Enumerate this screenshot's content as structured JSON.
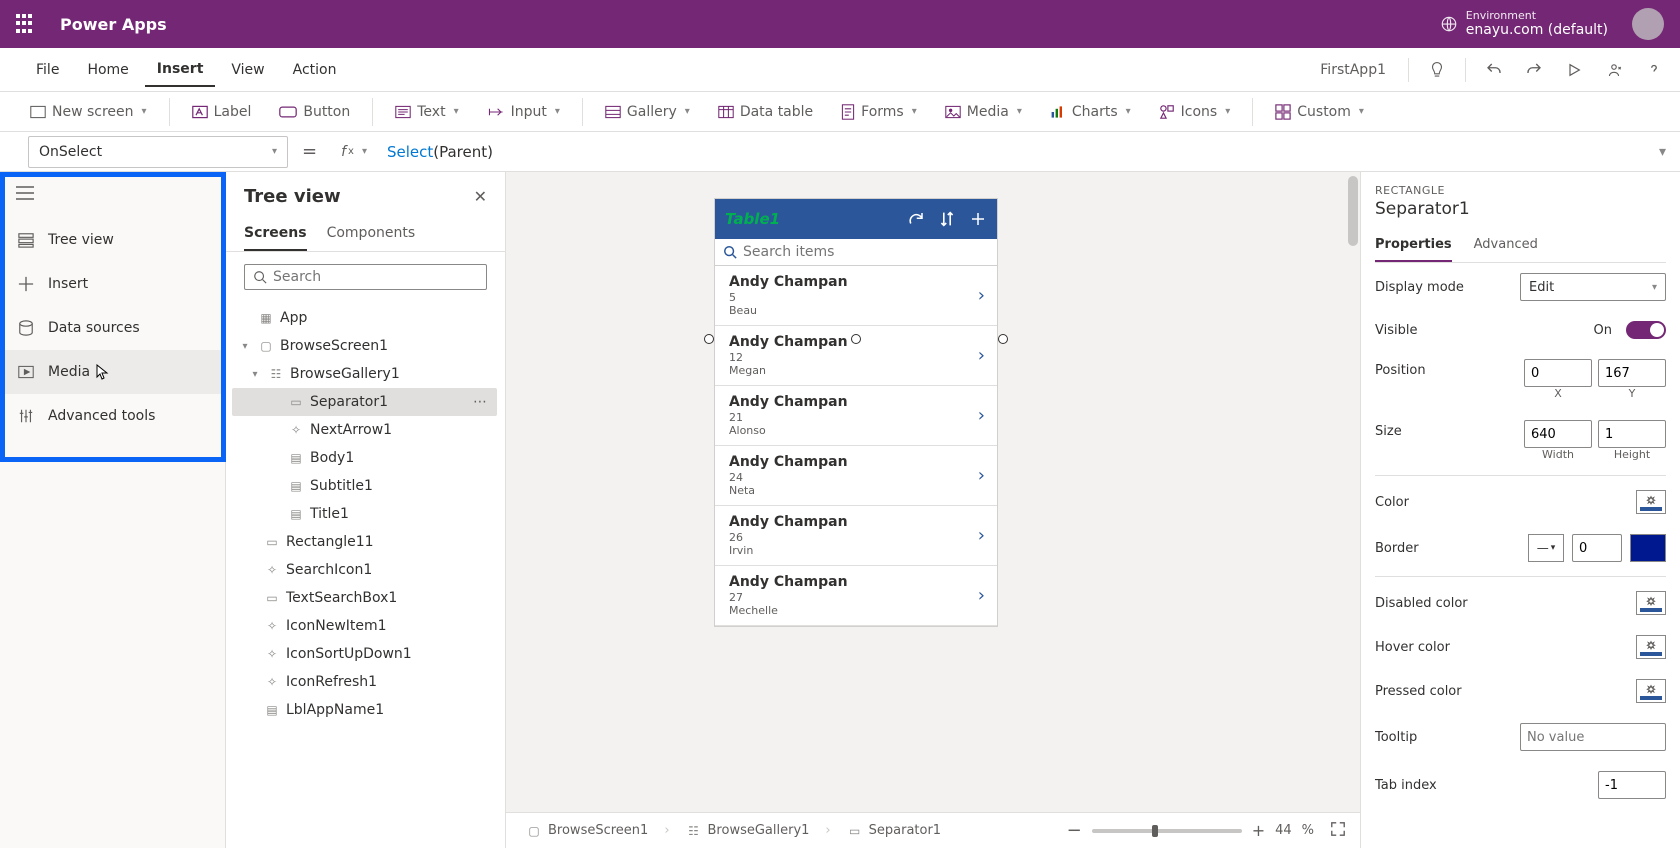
{
  "header": {
    "brand": "Power Apps",
    "env_label": "Environment",
    "env_name": "enayu.com (default)"
  },
  "menu": {
    "items": [
      "File",
      "Home",
      "Insert",
      "View",
      "Action"
    ],
    "active": "Insert",
    "app_name": "FirstApp1"
  },
  "ribbon": {
    "new_screen": "New screen",
    "label": "Label",
    "button": "Button",
    "text": "Text",
    "input": "Input",
    "gallery": "Gallery",
    "data_table": "Data table",
    "forms": "Forms",
    "media": "Media",
    "charts": "Charts",
    "icons": "Icons",
    "custom": "Custom"
  },
  "formula": {
    "property": "OnSelect",
    "fn": "Select",
    "arg": "(Parent)"
  },
  "rail": {
    "tree_view": "Tree view",
    "insert": "Insert",
    "data_sources": "Data sources",
    "media": "Media",
    "advanced": "Advanced tools"
  },
  "tree": {
    "title": "Tree view",
    "tab_screens": "Screens",
    "tab_components": "Components",
    "search_placeholder": "Search",
    "nodes": {
      "app": "App",
      "browse_screen": "BrowseScreen1",
      "browse_gallery": "BrowseGallery1",
      "separator": "Separator1",
      "next_arrow": "NextArrow1",
      "body": "Body1",
      "subtitle": "Subtitle1",
      "title": "Title1",
      "rectangle": "Rectangle11",
      "search_icon": "SearchIcon1",
      "text_search_box": "TextSearchBox1",
      "icon_new_item": "IconNewItem1",
      "icon_sort": "IconSortUpDown1",
      "icon_refresh": "IconRefresh1",
      "lbl_app_name": "LblAppName1"
    }
  },
  "preview": {
    "title": "Table1",
    "search_placeholder": "Search items",
    "items": [
      {
        "title": "Andy Champan",
        "line1": "5",
        "line2": "Beau"
      },
      {
        "title": "Andy Champan",
        "line1": "12",
        "line2": "Megan"
      },
      {
        "title": "Andy Champan",
        "line1": "21",
        "line2": "Alonso"
      },
      {
        "title": "Andy Champan",
        "line1": "24",
        "line2": "Neta"
      },
      {
        "title": "Andy Champan",
        "line1": "26",
        "line2": "Irvin"
      },
      {
        "title": "Andy Champan",
        "line1": "27",
        "line2": "Mechelle"
      }
    ]
  },
  "status": {
    "crumb1": "BrowseScreen1",
    "crumb2": "BrowseGallery1",
    "crumb3": "Separator1",
    "zoom": "44",
    "pct": "%"
  },
  "props": {
    "type": "RECTANGLE",
    "name": "Separator1",
    "tab_properties": "Properties",
    "tab_advanced": "Advanced",
    "display_mode": "Display mode",
    "display_mode_val": "Edit",
    "visible": "Visible",
    "visible_val": "On",
    "position": "Position",
    "position_x": "0",
    "position_y": "167",
    "x_label": "X",
    "y_label": "Y",
    "size": "Size",
    "size_w": "640",
    "size_h": "1",
    "w_label": "Width",
    "h_label": "Height",
    "color": "Color",
    "border": "Border",
    "border_val": "0",
    "disabled_color": "Disabled color",
    "hover_color": "Hover color",
    "pressed_color": "Pressed color",
    "tooltip": "Tooltip",
    "tooltip_placeholder": "No value",
    "tab_index": "Tab index",
    "tab_index_val": "-1"
  }
}
